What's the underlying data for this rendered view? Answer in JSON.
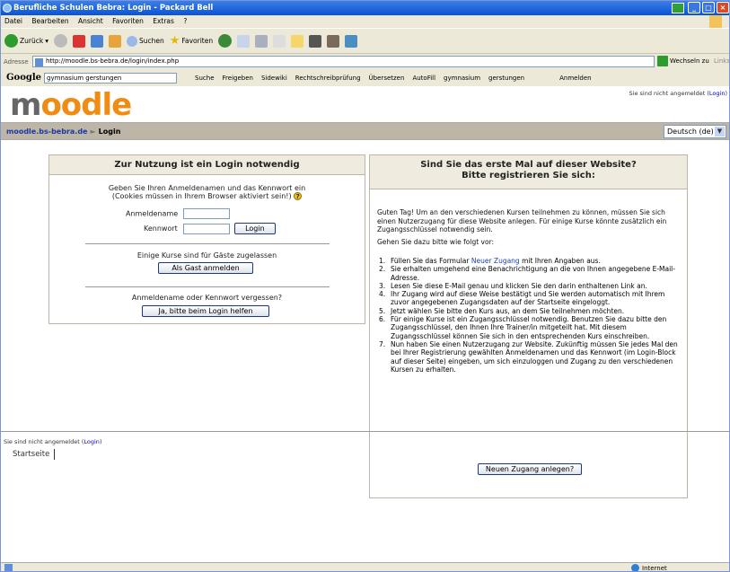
{
  "window": {
    "title": "Berufliche Schulen Bebra: Login - Packard Bell"
  },
  "menu": [
    "Datei",
    "Bearbeiten",
    "Ansicht",
    "Favoriten",
    "Extras",
    "?"
  ],
  "toolbar": {
    "back": "Zurück",
    "search": "Suchen",
    "favorites": "Favoriten"
  },
  "address": {
    "label": "Adresse",
    "url": "http://moodle.bs-bebra.de/login/index.php",
    "go": "Wechseln zu",
    "links": "Links"
  },
  "google": {
    "logo": "Google",
    "query": "gymnasium gerstungen",
    "items": [
      "Suche",
      "Freigeben",
      "Sidewiki",
      "Rechtschreibprüfung",
      "Übersetzen",
      "AutoFill",
      "gymnasium",
      "gerstungen",
      "Anmelden"
    ]
  },
  "header": {
    "logo_m": "m",
    "logo_rest": "oodle",
    "login_status": "Sie sind nicht angemeldet",
    "login_link": "Login"
  },
  "nav": {
    "home": "moodle.bs-bebra.de",
    "sep": "►",
    "current": "Login",
    "lang": "Deutsch (de)"
  },
  "login_box": {
    "title": "Zur Nutzung ist ein Login notwendig",
    "intro1": "Geben Sie Ihren Anmeldenamen und das Kennwort ein",
    "intro2": "(Cookies müssen in Ihrem Browser aktiviert sein!)",
    "username_label": "Anmeldename",
    "password_label": "Kennwort",
    "login_button": "Login",
    "guest_text": "Einige Kurse sind für Gäste zugelassen",
    "guest_button": "Als Gast anmelden",
    "forgot_text": "Anmeldename oder Kennwort vergessen?",
    "forgot_button": "Ja, bitte beim Login helfen"
  },
  "signup_box": {
    "title1": "Sind Sie das erste Mal auf dieser Website?",
    "title2": "Bitte registrieren Sie sich:",
    "para1": "Guten Tag! Um an den verschiedenen Kursen teilnehmen zu können, müssen Sie sich einen Nutzerzugang für diese Website anlegen. Für einige Kurse könnte zusätzlich ein Zugangsschlüssel notwendig sein.",
    "para2": "Gehen Sie dazu bitte wie folgt vor:",
    "step1_pre": "Füllen Sie das Formular ",
    "step1_link": "Neuer Zugang",
    "step1_post": " mit Ihren Angaben aus.",
    "steps": [
      "Sie erhalten umgehend eine Benachrichtigung an die von Ihnen angegebene E-Mail-Adresse.",
      "Lesen Sie diese E-Mail genau und klicken Sie den darin enthaltenen Link an.",
      "Ihr Zugang wird auf diese Weise bestätigt und Sie werden automatisch mit Ihrem zuvor angegebenen Zugangsdaten auf der Startseite eingeloggt.",
      "Jetzt wählen Sie bitte den Kurs aus, an dem Sie teilnehmen möchten.",
      "Für einige Kurse ist ein Zugangsschlüssel notwendig. Benutzen Sie dazu bitte den Zugangsschlüssel, den Ihnen Ihre Trainer/in mitgeteilt hat. Mit diesem Zugangsschlüssel können Sie sich in den entsprechenden Kurs einschreiben.",
      "Nun haben Sie einen Nutzerzugang zur Website. Zukünftig müssen Sie jedes Mal den bei Ihrer Registrierung gewählten Anmeldenamen und das Kennwort (im Login-Block auf dieser Seite) eingeben, um sich einzuloggen und Zugang zu den verschiedenen Kursen zu erhalten."
    ],
    "button": "Neuen Zugang anlegen?"
  },
  "footer": {
    "status": "Sie sind nicht angemeldet",
    "login_link": "Login",
    "home": "Startseite"
  },
  "statusbar": {
    "zone": "Internet"
  }
}
